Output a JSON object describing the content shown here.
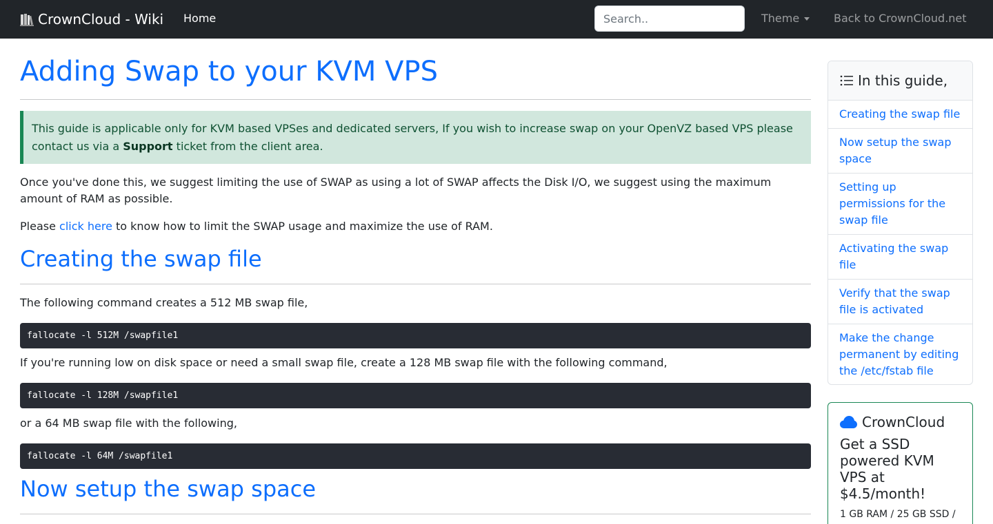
{
  "navbar": {
    "brand": "CrownCloud - Wiki",
    "home": "Home",
    "search_placeholder": "Search..",
    "theme": "Theme",
    "back": "Back to CrownCloud.net"
  },
  "page": {
    "title": "Adding Swap to your KVM VPS",
    "alert_prefix": "This guide is applicable only for KVM based VPSes and dedicated servers, If you wish to increase swap on your OpenVZ based VPS please contact us via a ",
    "alert_link": "Support",
    "alert_suffix": " ticket from the client area.",
    "intro": "Once you've done this, we suggest limiting the use of SWAP as using a lot of SWAP affects the Disk I/O, we suggest using the maximum amount of RAM as possible.",
    "please_prefix": "Please ",
    "please_link": "click here",
    "please_suffix": " to know how to limit the SWAP usage and maximize the use of RAM."
  },
  "sections": {
    "creating": {
      "heading": "Creating the swap file",
      "text1": "The following command creates a 512 MB swap file,",
      "code1": "fallocate -l 512M /swapfile1",
      "text2": "If you're running low on disk space or need a small swap file, create a 128 MB swap file with the following command,",
      "code2": "fallocate -l 128M /swapfile1",
      "text3": "or a 64 MB swap file with the following,",
      "code3": "fallocate -l 64M /swapfile1"
    },
    "setup": {
      "heading": "Now setup the swap space"
    }
  },
  "toc": {
    "title": "In this guide,",
    "items": [
      "Creating the swap file",
      "Now setup the swap space",
      "Setting up permissions for the swap file",
      "Activating the swap file",
      "Verify that the swap file is activated",
      "Make the change permanent by editing the /etc/fstab file"
    ]
  },
  "promo": {
    "brand": "CrownCloud",
    "title": "Get a SSD powered KVM VPS at $4.5/month!",
    "specs": "1 GB RAM / 25 GB SSD /"
  },
  "colors": {
    "link": "#0d6efd",
    "navbar": "#212529",
    "alert_bg": "#d1e7dd",
    "alert_border": "#198754",
    "code_bg": "#282c34"
  }
}
